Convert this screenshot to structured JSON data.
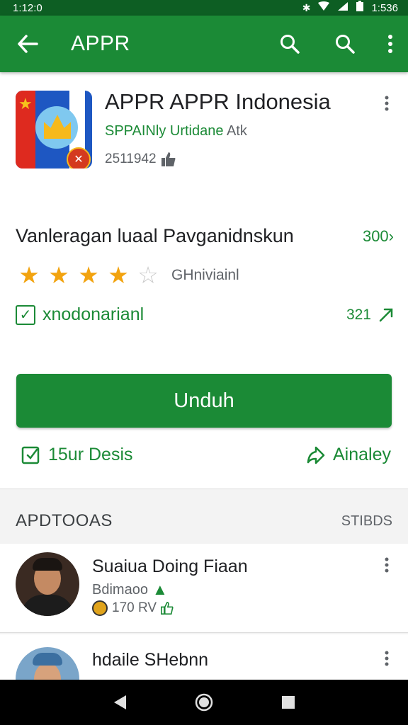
{
  "status_bar": {
    "time": "1:12:0",
    "right_time": "1:536",
    "icons": [
      "bluetooth-icon",
      "wifi-icon",
      "signal-icon",
      "battery-icon"
    ]
  },
  "app_bar": {
    "title": "APPR",
    "back_icon": "arrow-left-icon",
    "actions": [
      "search-icon",
      "search-icon",
      "more-vert-icon"
    ]
  },
  "app": {
    "name": "APPR APPR Indonesia",
    "developer_highlight": "SPPAINly Urtidane",
    "developer_rest": " Atk",
    "size": "2511942",
    "size_icon": "thumb-up-icon"
  },
  "details": {
    "description": "Vanleragan luaal Pavganidnskun",
    "description_count": "300",
    "rating": 4,
    "rating_max": 5,
    "rating_label": "GHniviainl",
    "checkbox_label": "xnodonarianl",
    "checkbox_count": "321"
  },
  "install_button": {
    "label": "Unduh"
  },
  "sub_actions": {
    "left_label": "15ur Desis",
    "right_label": "Ainaley"
  },
  "reviews_section": {
    "heading": "APDTOOAS",
    "link": "STIBDS",
    "reviews": [
      {
        "name": "Suaiua Doing Fiaan",
        "sub": "Bdimaoo",
        "meta": "170 RV"
      },
      {
        "name": "hdaile SHebnn",
        "sub": "",
        "meta": ""
      }
    ]
  },
  "colors": {
    "primary": "#1b8a36",
    "status_bar": "#0d5e23",
    "star": "#f2a30f"
  },
  "nav_bar": {
    "buttons": [
      "back-triangle-icon",
      "home-circle-icon",
      "recents-square-icon"
    ]
  }
}
